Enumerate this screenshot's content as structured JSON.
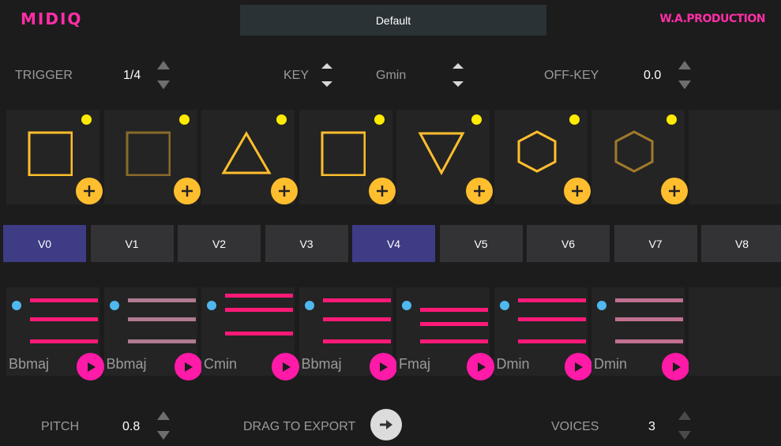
{
  "header": {
    "logo_left": "MIDIQ",
    "logo_right": "W.A.PRODUCTION",
    "preset": "Default"
  },
  "controls": {
    "trigger_label": "TRIGGER",
    "trigger_value": "1/4",
    "key_label": "KEY",
    "key_value": "Gmin",
    "offkey_label": "OFF-KEY",
    "offkey_value": "0.0"
  },
  "shapes": [
    {
      "shape": "square",
      "color": "#ffbe2e"
    },
    {
      "shape": "square",
      "color": "#8a6a2a"
    },
    {
      "shape": "triangle-up",
      "color": "#ffbe2e"
    },
    {
      "shape": "square",
      "color": "#ffbe2e"
    },
    {
      "shape": "triangle-down",
      "color": "#ffbe2e"
    },
    {
      "shape": "hexagon",
      "color": "#ffbe2e"
    },
    {
      "shape": "hexagon",
      "color": "#a07a2a"
    }
  ],
  "voices_tabs": [
    "V0",
    "V1",
    "V2",
    "V3",
    "V4",
    "V5",
    "V6",
    "V7",
    "V8"
  ],
  "selected_tabs": [
    "V0",
    "V4"
  ],
  "chords": [
    {
      "name": "Bbmaj",
      "color": "#ff1a78"
    },
    {
      "name": "Bbmaj",
      "color": "#b07a90"
    },
    {
      "name": "Cmin",
      "color": "#ff1a78"
    },
    {
      "name": "Bbmaj",
      "color": "#ff1a78"
    },
    {
      "name": "Fmaj",
      "color": "#ff1a78"
    },
    {
      "name": "Dmin",
      "color": "#ff1a78"
    },
    {
      "name": "Dmin",
      "color": "#c07090"
    }
  ],
  "footer": {
    "pitch_label": "PITCH",
    "pitch_value": "0.8",
    "export_label": "DRAG TO EXPORT",
    "voices_label": "VOICES",
    "voices_value": "3"
  },
  "icons": {
    "stepper": "up-down-arrows-icon",
    "add": "plus-icon",
    "play": "play-icon",
    "export": "arrow-right-icon"
  },
  "colors": {
    "accent_pink": "#ff2ea6",
    "accent_yellow": "#ffbe2e",
    "indicator_yellow": "#ffeb00",
    "indicator_blue": "#4fb8ef",
    "selected_tab": "#3e3c84"
  }
}
